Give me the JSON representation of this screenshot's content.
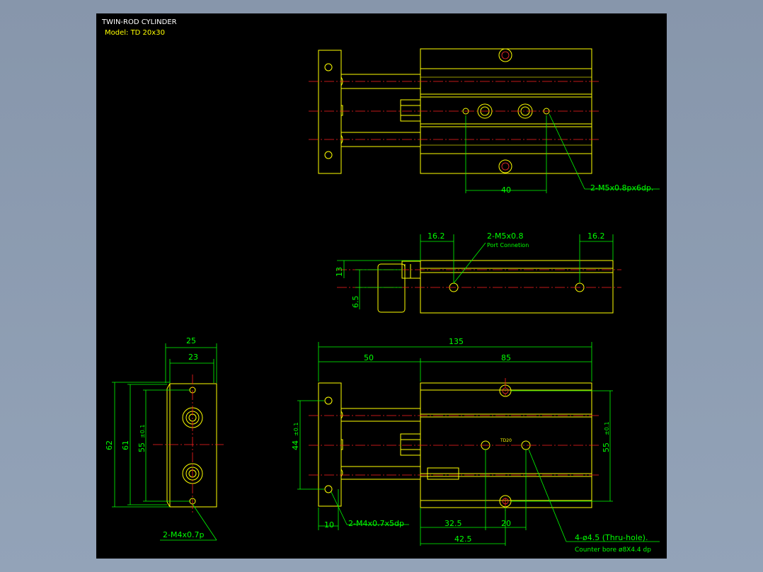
{
  "title": {
    "line1": "TWIN-ROD CYLINDER",
    "line2": "Model:  TD  20x30"
  },
  "dimensions": {
    "top_view": {
      "d40": "40",
      "thread_note": "2-M5x0.8px6dp."
    },
    "side_view": {
      "d16_2_left": "16.2",
      "d16_2_right": "16.2",
      "port_thread": "2-M5x0.8",
      "port_note": "Port Connetion",
      "d13": "13",
      "d6_5": "6.5"
    },
    "end_view": {
      "d25": "25",
      "d23": "23",
      "d62": "62",
      "d61": "61",
      "d55": "55",
      "d55_tol": "±0.1",
      "thread_note": "2-M4x0.7p"
    },
    "front_view": {
      "d135": "135",
      "d50": "50",
      "d85": "85",
      "d44": "44",
      "d44_tol": "±0.1",
      "d55": "55",
      "d55_tol": "±0.1",
      "d10": "10",
      "plate_thread": "2-M4x0.7x5dp",
      "d32_5": "32.5",
      "d20": "20",
      "d42_5": "42.5",
      "holes_note": "4-ø4.5 (Thru-hole).",
      "cbore_note": "Counter bore ø8X4.4 dp",
      "label_td20": "TD20"
    }
  },
  "colors": {
    "background": "#000000",
    "outline": "#ffff00",
    "dimension": "#00ff00",
    "centerline": "#ff2020",
    "title": "#ffffff",
    "model": "#ffff00"
  }
}
